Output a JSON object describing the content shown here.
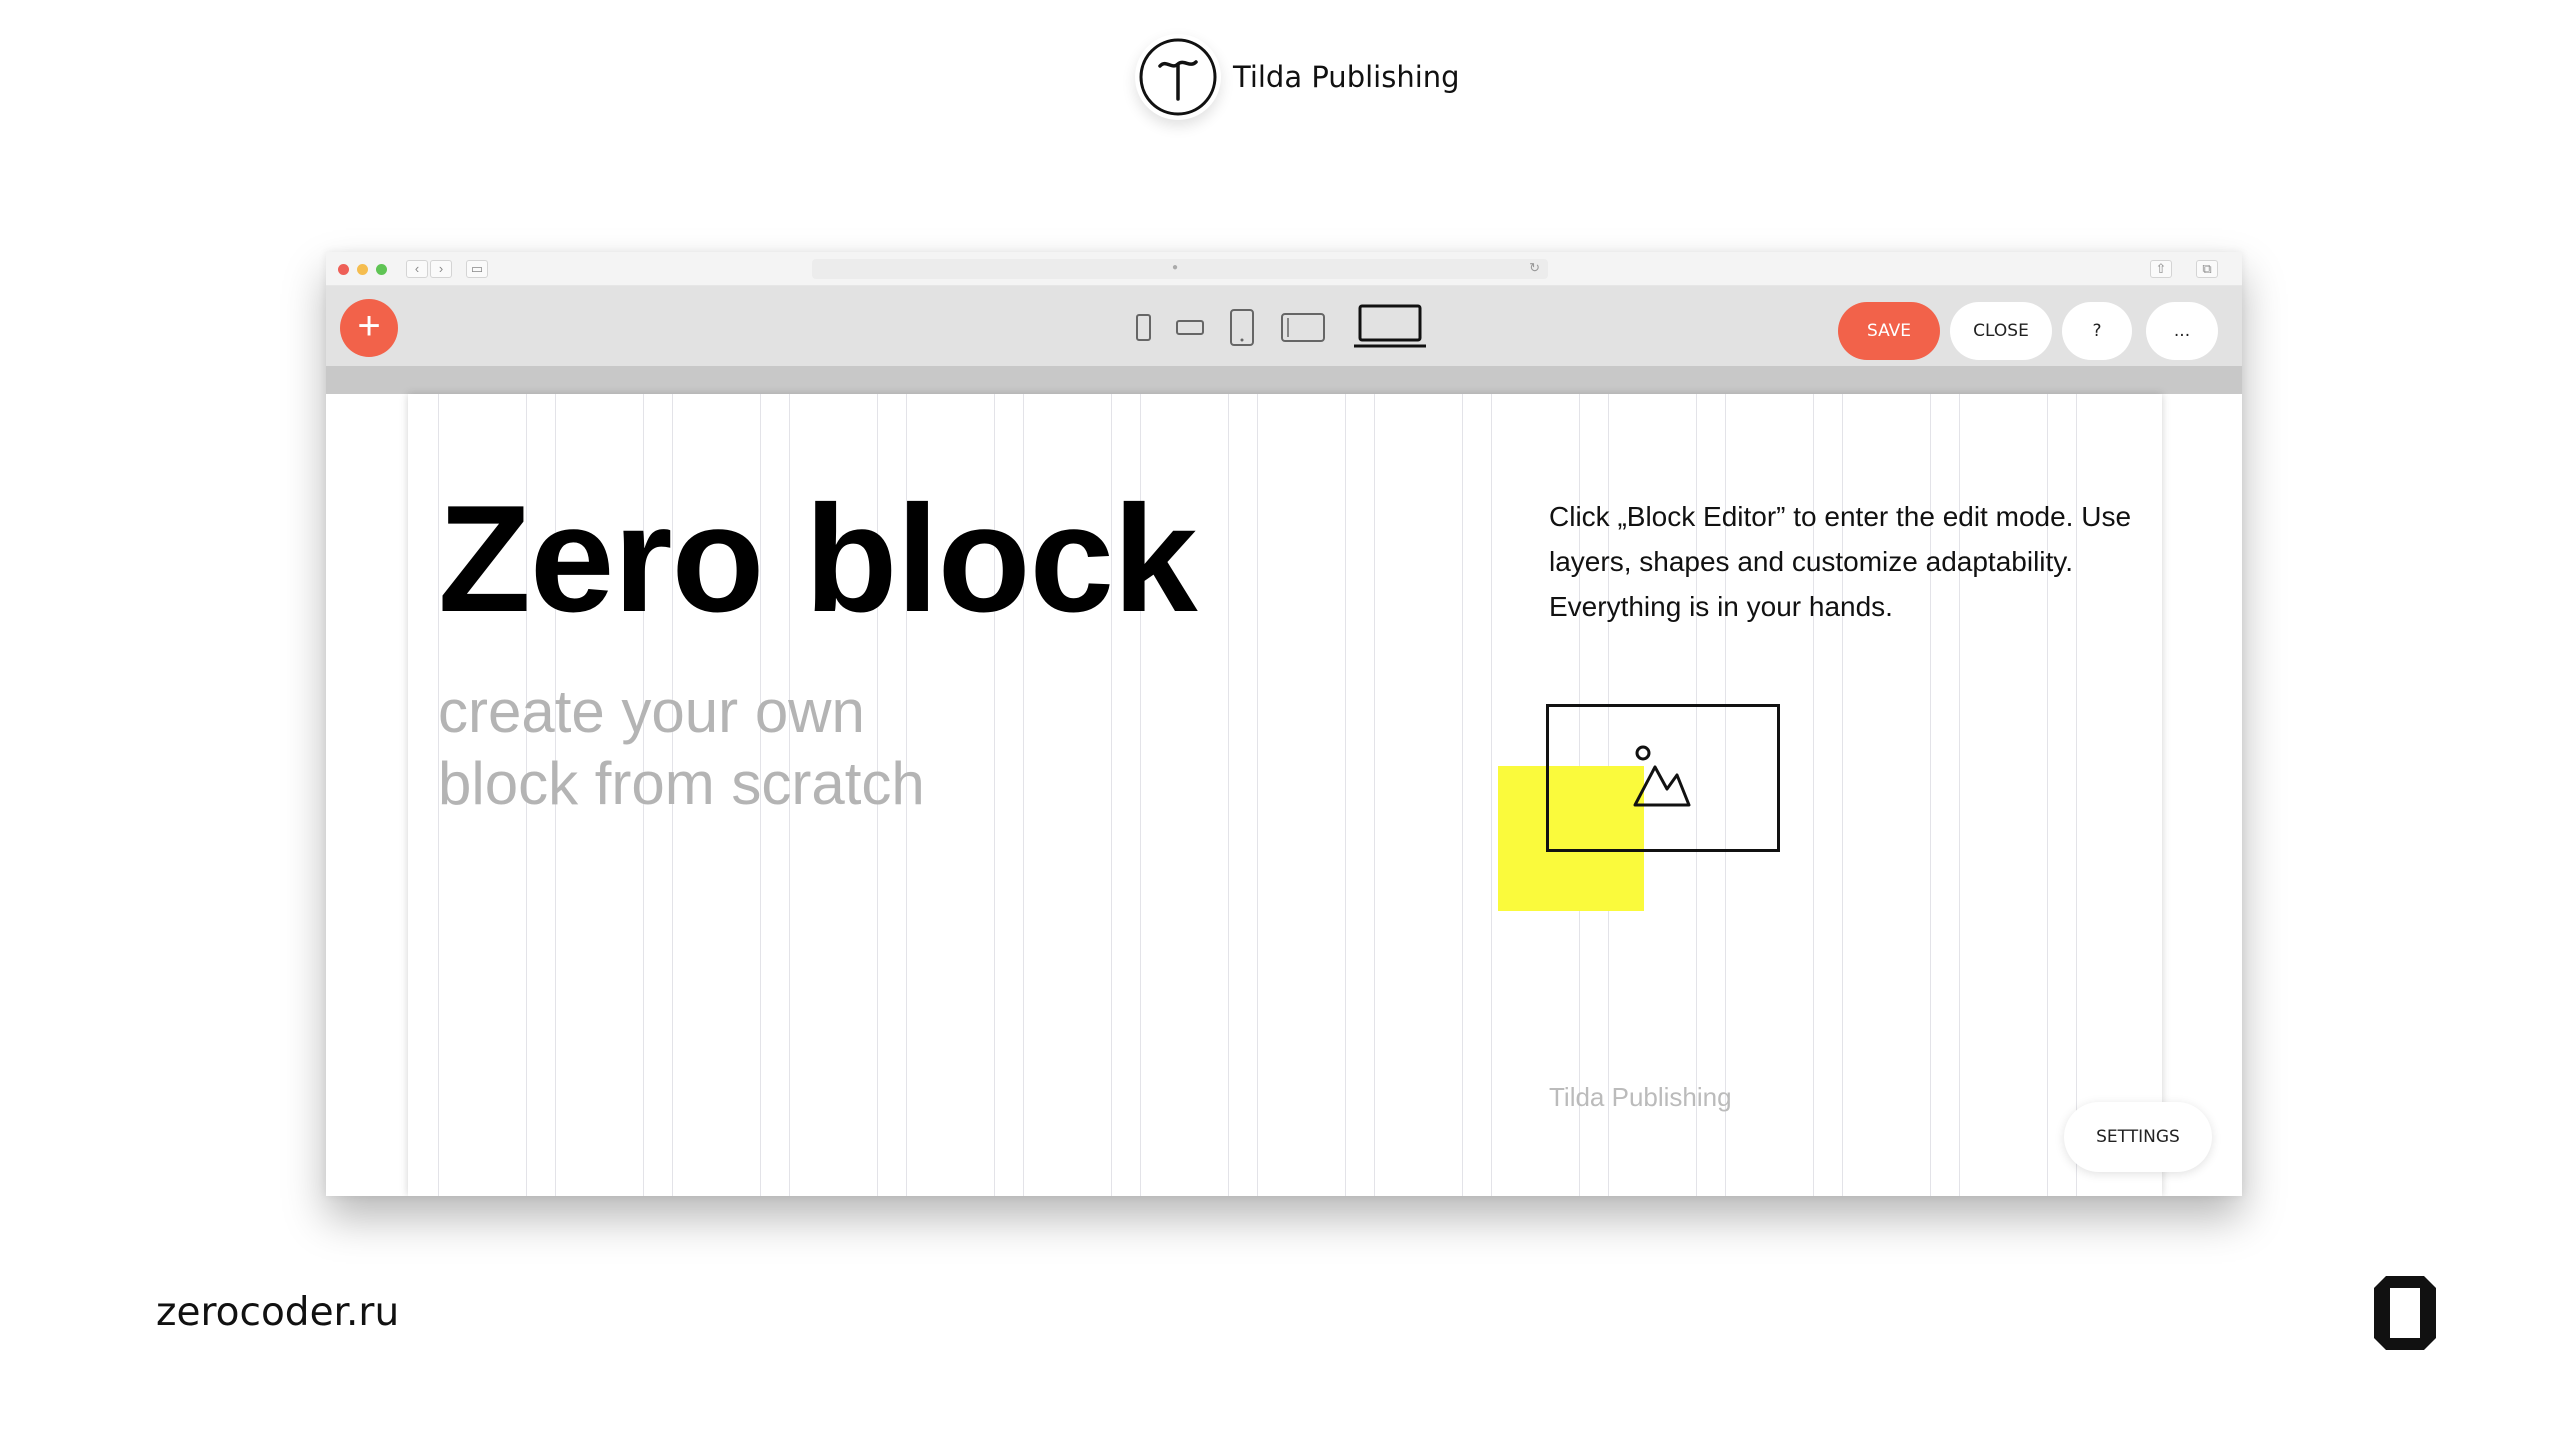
{
  "brand": {
    "name": "Tilda Publishing",
    "logo_icon": "tilda-logo-icon"
  },
  "browser": {
    "url": ""
  },
  "toolbar": {
    "add_icon": "+",
    "devices": [
      "phone-portrait-icon",
      "phone-landscape-icon",
      "tablet-portrait-icon",
      "tablet-landscape-icon",
      "desktop-icon"
    ],
    "active_device": "desktop-icon",
    "save_label": "SAVE",
    "close_label": "CLOSE",
    "help_label": "?",
    "more_label": "...",
    "accent_color": "#f2624a"
  },
  "canvas": {
    "title": "Zero block",
    "subtitle_line1": "create your own",
    "subtitle_line2": "block from scratch",
    "description": "Click „Block Editor” to enter the edit mode. Use layers, shapes and customize adaptability. Everything is in your hands.",
    "image_placeholder_icon": "image-icon",
    "highlight_color": "#fafa3c",
    "footer_text": "Tilda Publishing",
    "settings_label": "SETTINGS"
  },
  "footer": {
    "site": "zerocoder.ru",
    "logo_icon": "zerocoder-logo-icon"
  }
}
